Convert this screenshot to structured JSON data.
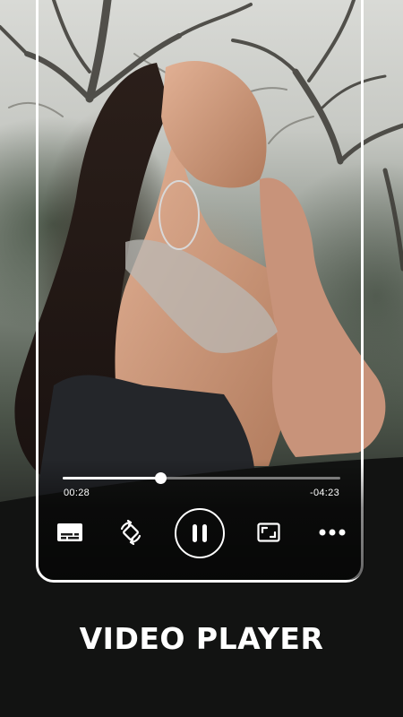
{
  "player": {
    "elapsed": "00:28",
    "remaining": "-04:23",
    "progress": 0.35,
    "state": "playing"
  },
  "controls": {
    "subtitles_icon": "subtitles-icon",
    "rotate_icon": "screen-rotate-icon",
    "pause_icon": "pause-icon",
    "fit_icon": "aspect-ratio-icon",
    "more_icon": "more-horizontal-icon"
  },
  "promo": {
    "title": "VIDEO PLAYER"
  },
  "colors": {
    "controls": "#ffffff",
    "frame": "#ffffff"
  }
}
